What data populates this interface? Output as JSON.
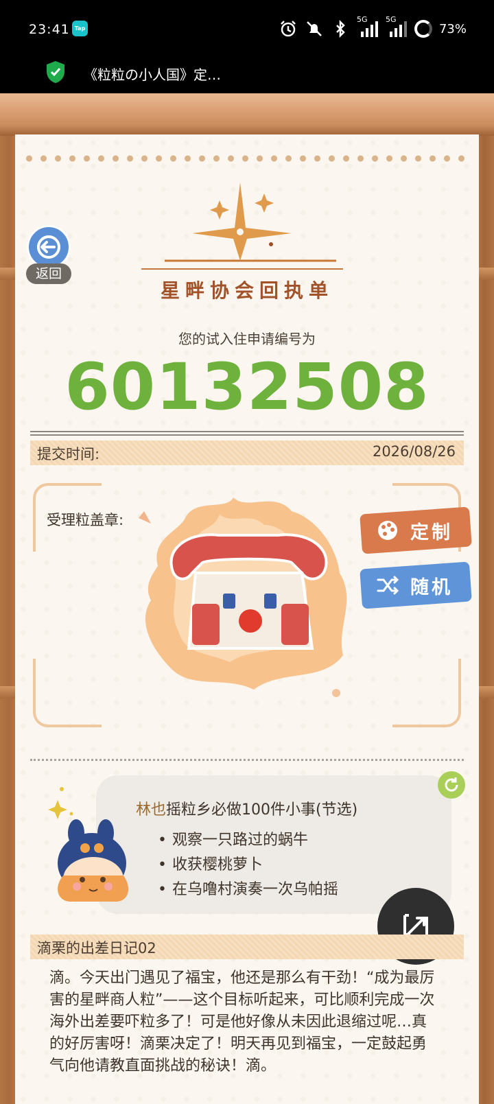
{
  "status_bar": {
    "time": "23:41",
    "tap_badge": "Tap",
    "network_1": "5G",
    "network_2": "5G",
    "battery": "73%"
  },
  "app_bar": {
    "title": "《粒粒の小人国》定…"
  },
  "back_button": {
    "label": "返回"
  },
  "logo": {
    "text": "星畔协会回执单"
  },
  "application": {
    "subtitle": "您的试入住申请编号为",
    "number": "60132508"
  },
  "submit": {
    "label": "提交时间:",
    "date": "2026/08/26"
  },
  "stamp": {
    "label": "受理粒盖章:",
    "custom_label": "定制",
    "random_label": "随机"
  },
  "bubble": {
    "name": "林也",
    "title_rest": "摇粒乡必做100件小事(节选)",
    "items": [
      "观察一只路过的蜗牛",
      "收获樱桃萝卜",
      "在乌噜村演奏一次乌帕摇"
    ]
  },
  "diary": {
    "title": "滴栗的出差日记02",
    "body": "滴。今天出门遇见了福宝，他还是那么有干劲！“成为最厉害的星畔商人粒”——这个目标听起来，可比顺利完成一次海外出差要吓粒多了！可是他好像从未因此退缩过呢…真的好厉害呀！滴栗决定了！明天再见到福宝，一定鼓起勇气向他请教直面挑战的秘诀！滴。"
  },
  "colors": {
    "number_green": "#6eb13c",
    "custom_orange": "#d87a4c",
    "random_blue": "#5f94d9",
    "back_blue": "#5a8fd6",
    "refresh_green": "#a9cf58"
  }
}
